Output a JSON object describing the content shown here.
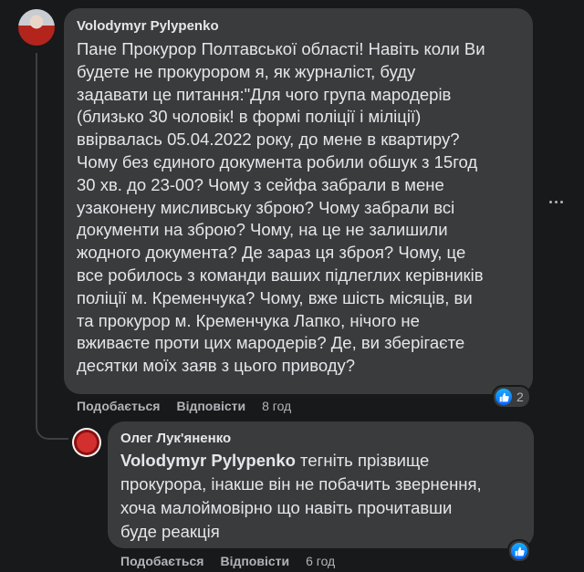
{
  "comment": {
    "author": "Volodymyr Pylypenko",
    "text": "Пане Прокурор Полтавської області! Навіть коли Ви\nбудете не прокурором я, як журналіст, буду\nзадавати це питання:\"Для чого група мародерів\n(близько 30 чоловік! в формі поліції і міліції)\nввірвалась 05.04.2022 року, до мене в квартиру?\nЧому без єдиного документа робили обшук з 15год\n30 хв. до 23-00? Чому з сейфа забрали в мене\nузаконену мисливську зброю? Чому забрали всі\nдокументи на зброю? Чому, на це не залишили\nжодного документа? Де зараз ця зброя? Чому, це\nвсе робилось з команди ваших підлеглих керівників\nполіції м. Кременчука? Чому, вже шість місяців, ви\nта прокурор м. Кременчука Лапко, нічого не\nвживаєте проти цих мародерів? Де, ви зберігаєте\nдесятки моїх заяв з цього приводу?",
    "like_label": "Подобається",
    "reply_label": "Відповісти",
    "time": "8 год",
    "reaction_count": "2"
  },
  "reply": {
    "author": "Олег Лук'яненко",
    "mention": "Volodymyr Pylypenko",
    "text": " тегніть прізвище\nпрокурора, інакше він не побачить звернення,\nхоча малоймовірно що навіть прочитавши\nбуде реакція",
    "like_label": "Подобається",
    "reply_label": "Відповісти",
    "time": "6 год"
  },
  "icons": {
    "like": "like-thumb-icon",
    "more": "more-options-icon"
  },
  "colors": {
    "background": "#18191a",
    "bubble": "#3a3b3c",
    "text": "#e4e6eb",
    "secondary": "#b0b3b8",
    "like_blue": "#0766ff"
  }
}
